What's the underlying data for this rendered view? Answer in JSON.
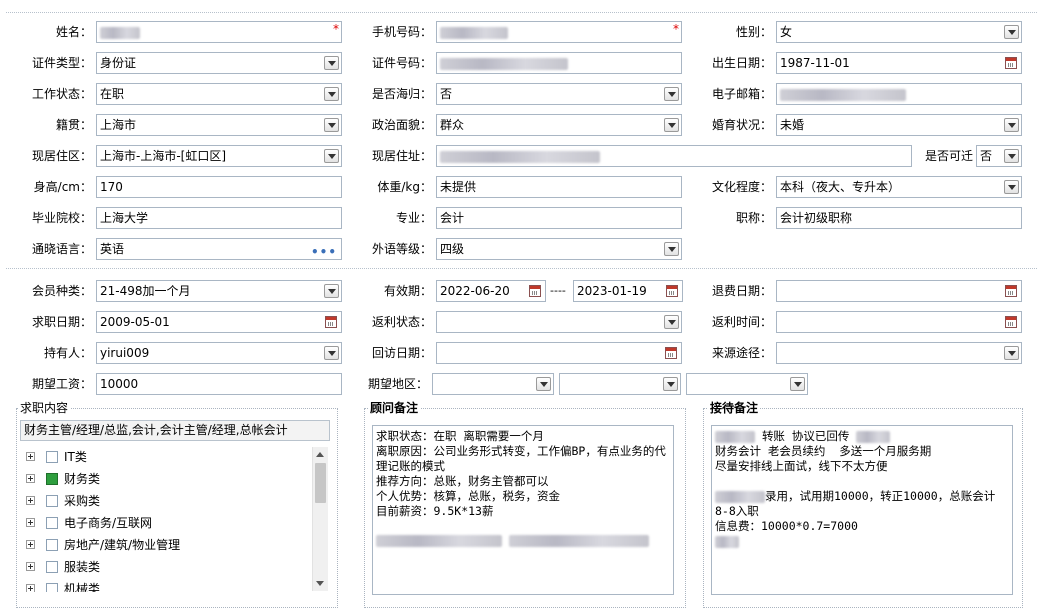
{
  "personal": {
    "name_label": "姓名：",
    "phone_label": "手机号码：",
    "gender_label": "性别：",
    "gender_value": "女",
    "idtype_label": "证件类型：",
    "idtype_value": "身份证",
    "idno_label": "证件号码：",
    "birth_label": "出生日期：",
    "birth_value": "1987-11-01",
    "workstatus_label": "工作状态：",
    "workstatus_value": "在职",
    "overseas_label": "是否海归：",
    "overseas_value": "否",
    "email_label": "电子邮箱：",
    "native_label": "籍贯：",
    "native_value": "上海市",
    "political_label": "政治面貌：",
    "political_value": "群众",
    "marital_label": "婚育状况：",
    "marital_value": "未婚",
    "residence_label": "现居住区：",
    "residence_value": "上海市-上海市-[虹口区]",
    "address_label": "现居住址：",
    "can_move_label": "是否可迁",
    "can_move_value": "否",
    "height_label": "身高/cm：",
    "height_value": "170",
    "weight_label": "体重/kg：",
    "weight_value": "未提供",
    "education_label": "文化程度：",
    "education_value": "本科（夜大、专升本）",
    "school_label": "毕业院校：",
    "school_value": "上海大学",
    "major_label": "专业：",
    "major_value": "会计",
    "title_label": "职称：",
    "title_value": "会计初级职称",
    "language_label": "通晓语言：",
    "language_value": "英语",
    "langlevel_label": "外语等级：",
    "langlevel_value": "四级"
  },
  "membership": {
    "type_label": "会员种类：",
    "type_value": "21-498加一个月",
    "valid_label": "有效期：",
    "valid_from": "2022-06-20",
    "valid_sep": "----",
    "valid_to": "2023-01-19",
    "refund_label": "退费日期：",
    "jobdate_label": "求职日期：",
    "jobdate_value": "2009-05-01",
    "rebate_status_label": "返利状态：",
    "rebate_time_label": "返利时间：",
    "holder_label": "持有人：",
    "holder_value": "yirui009",
    "visit_label": "回访日期：",
    "source_label": "来源途径：",
    "salary_label": "期望工资：",
    "salary_value": "10000",
    "region_label": "期望地区："
  },
  "job_content": {
    "title": "求职内容",
    "summary": "财务主管/经理/总监,会计,会计主管/经理,总帐会计",
    "tree": [
      {
        "label": "IT类",
        "checked": false
      },
      {
        "label": "财务类",
        "checked": true
      },
      {
        "label": "采购类",
        "checked": false
      },
      {
        "label": "电子商务/互联网",
        "checked": false
      },
      {
        "label": "房地产/建筑/物业管理",
        "checked": false
      },
      {
        "label": "服装类",
        "checked": false
      },
      {
        "label": "机械类",
        "checked": false
      }
    ]
  },
  "advisor_notes": {
    "title": "顾问备注",
    "lines": [
      "求职状态：在职 离职需要一个月",
      "离职原因：公司业务形式转变，工作偏BP，有点业务的代理记账的模式",
      "推荐方向：总账，财务主管都可以",
      "个人优势：核算，总账，税务，资金",
      "目前薪资：9.5K*13薪"
    ]
  },
  "reception_notes": {
    "title": "接待备注",
    "line1": "转账 协议已回传",
    "line2": "财务会计 老会员续约  多送一个月服务期",
    "line3": "尽量安排线上面试，线下不太方便",
    "line5": "录用，试用期10000，转正10000，总账会计8-8入职",
    "line6": "信息费：10000*0.7=7000"
  },
  "colors": {
    "border": "#a9b6c4",
    "required": "#dd0000",
    "checked": "#2e9e3e"
  }
}
